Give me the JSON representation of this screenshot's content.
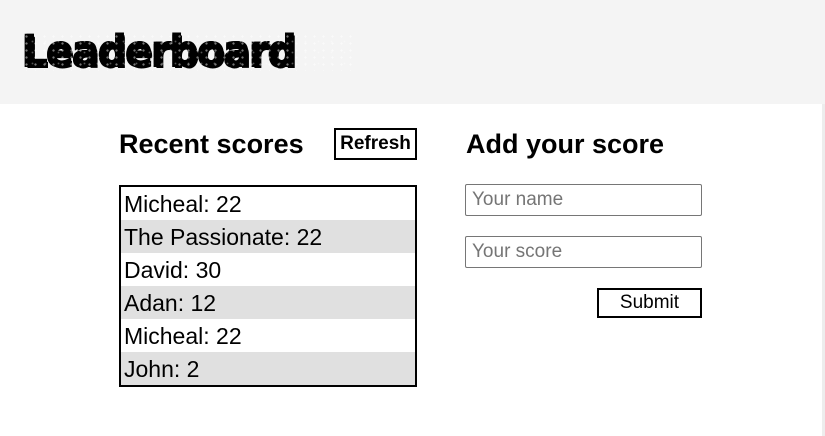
{
  "header": {
    "title": "Leaderboard",
    "background": "#f4f4f4"
  },
  "recent": {
    "title": "Recent scores",
    "refresh_label": "Refresh",
    "scores": [
      "Micheal: 22",
      "The Passionate: 22",
      "David: 30",
      "Adan: 12",
      "Micheal: 22",
      "John: 2"
    ],
    "stripe_color": "#e0e0e0"
  },
  "add": {
    "title": "Add your score",
    "name_placeholder": "Your name",
    "name_value": "",
    "score_placeholder": "Your score",
    "score_value": "",
    "submit_label": "Submit"
  }
}
